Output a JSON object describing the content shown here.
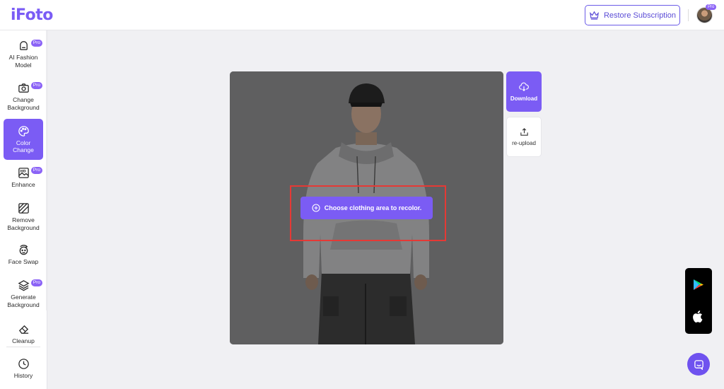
{
  "app": {
    "logo": "iFoto"
  },
  "header": {
    "restore_label": "Restore Subscription",
    "avatar_badge": "Pro"
  },
  "sidebar": {
    "items": [
      {
        "label": "AI Fashion\nModel",
        "icon": "hanger-icon",
        "pro": "Pro",
        "active": false
      },
      {
        "label": "Change\nBackground",
        "icon": "camera-icon",
        "pro": "Pro",
        "active": false
      },
      {
        "label": "Color\nChange",
        "icon": "palette-icon",
        "pro": "",
        "active": true
      },
      {
        "label": "Enhance",
        "icon": "hd-image-icon",
        "pro": "Pro",
        "active": false
      },
      {
        "label": "Remove\nBackground",
        "icon": "remove-background-icon",
        "pro": "",
        "active": false
      },
      {
        "label": "Face Swap",
        "icon": "face-swap-icon",
        "pro": "",
        "active": false
      },
      {
        "label": "Generate\nBackground",
        "icon": "layers-icon",
        "pro": "Pro",
        "active": false
      },
      {
        "label": "Cleanup",
        "icon": "eraser-icon",
        "pro": "",
        "active": false
      },
      {
        "label": "History",
        "icon": "clock-icon",
        "pro": "",
        "active": false
      }
    ]
  },
  "canvas": {
    "prompt_label": "Choose clothing area to recolor."
  },
  "actions": {
    "download_label": "Download",
    "reupload_label": "re-upload"
  },
  "colors": {
    "accent": "#7b5cf4",
    "highlight": "#e53935",
    "app_bg": "#f0f0f3"
  }
}
